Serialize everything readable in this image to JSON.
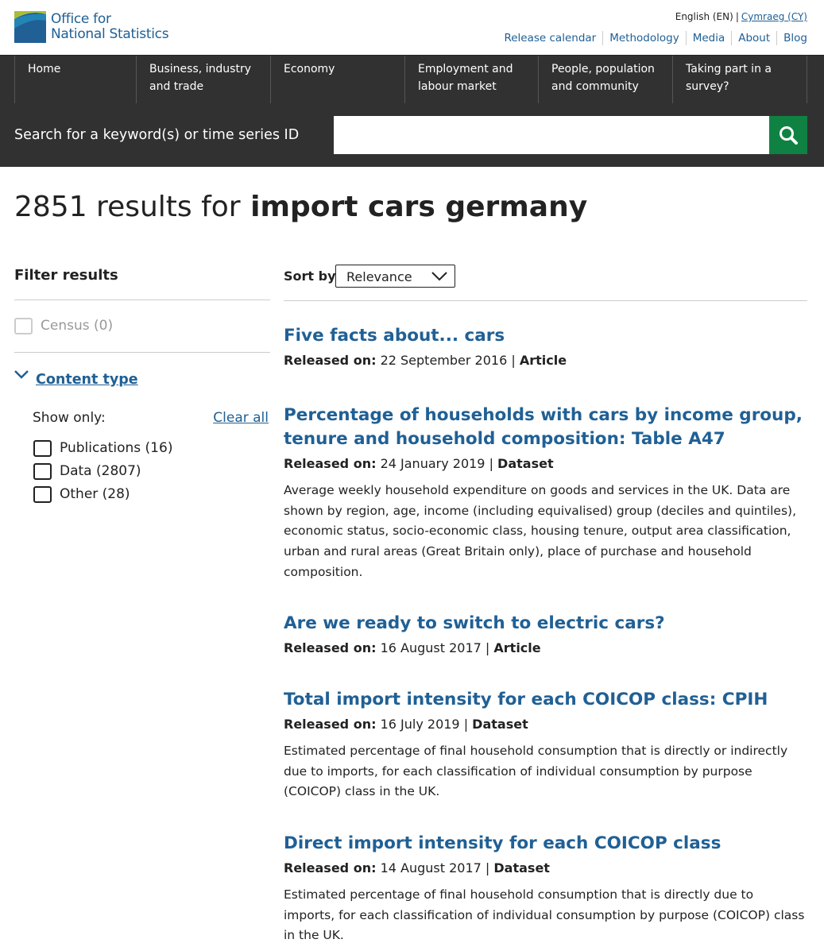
{
  "header": {
    "logo_line1": "Office for",
    "logo_line2": "National Statistics",
    "lang_current": "English (EN)",
    "lang_other": "Cymraeg (CY)",
    "links": [
      "Release calendar",
      "Methodology",
      "Media",
      "About",
      "Blog"
    ]
  },
  "nav": {
    "items": [
      "Home",
      "Business, industry and trade",
      "Economy",
      "Employment and labour market",
      "People, population and community",
      "Taking part in a survey?"
    ]
  },
  "search": {
    "label": "Search for a keyword(s) or time series ID",
    "value": ""
  },
  "results_header": {
    "count_text": "2851 results for",
    "query": "import cars germany"
  },
  "filters": {
    "heading": "Filter results",
    "census": "Census (0)",
    "content_type": "Content type",
    "show_only": "Show only:",
    "clear_all": "Clear all",
    "options": [
      "Publications (16)",
      "Data (2807)",
      "Other (28)"
    ]
  },
  "sort": {
    "label": "Sort by",
    "value": "Relevance"
  },
  "results": [
    {
      "title": "Five facts about... cars",
      "released_label": "Released on:",
      "date": "22 September 2016",
      "type": "Article",
      "desc": ""
    },
    {
      "title": "Percentage of households with cars by income group, tenure and household composition: Table A47",
      "released_label": "Released on:",
      "date": "24 January 2019",
      "type": "Dataset",
      "desc": "Average weekly household expenditure on goods and services in the UK. Data are shown by region, age, income (including equivalised) group (deciles and quintiles), economic status, socio-economic class, housing tenure, output area classification, urban and rural areas (Great Britain only), place of purchase and household composition."
    },
    {
      "title": "Are we ready to switch to electric cars?",
      "released_label": "Released on:",
      "date": "16 August 2017",
      "type": "Article",
      "desc": ""
    },
    {
      "title": "Total import intensity for each COICOP class: CPIH",
      "released_label": "Released on:",
      "date": "16 July 2019",
      "type": "Dataset",
      "desc": "Estimated percentage of final household consumption that is directly or indirectly due to imports, for each classification of individual consumption by purpose (COICOP) class in the UK."
    },
    {
      "title": "Direct import intensity for each COICOP class",
      "released_label": "Released on:",
      "date": "14 August 2017",
      "type": "Dataset",
      "desc": "Estimated percentage of final household consumption that is directly due to imports, for each classification of individual consumption by purpose (COICOP) class in the UK."
    }
  ],
  "colors": {
    "brand_blue": "#206095",
    "nav_bg": "#323132",
    "search_button": "#0f8243"
  }
}
